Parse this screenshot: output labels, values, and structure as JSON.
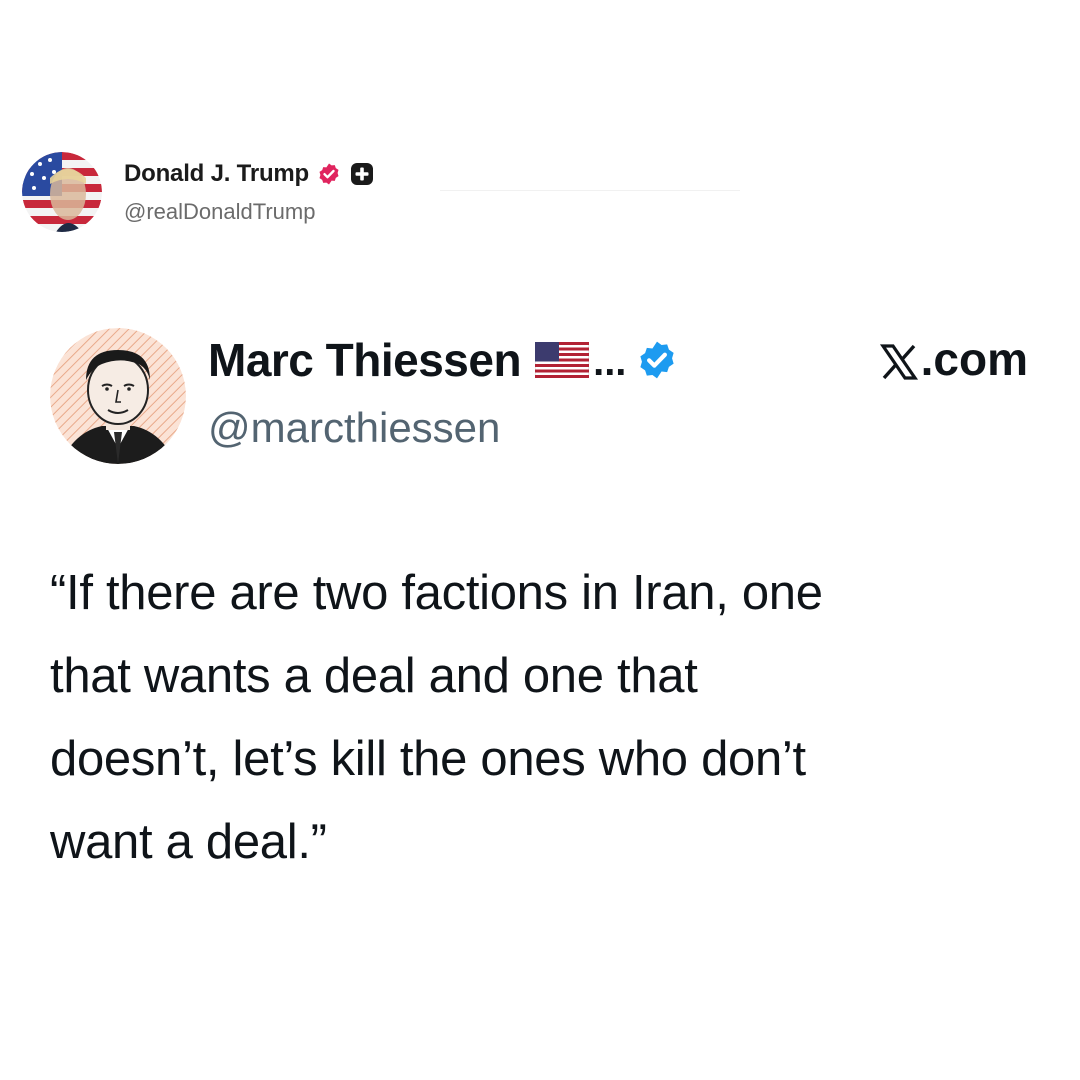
{
  "post": {
    "author_name": "Donald J. Trump",
    "author_handle": "@realDonaldTrump",
    "avatar_icon": "flag-portrait-avatar",
    "badge_icon": "verified-badge-icon",
    "badge_color": "#e0245e",
    "plus_icon": "plus-icon"
  },
  "embedded_tweet": {
    "author_name": "Marc Thiessen",
    "flag_icon": "us-flag-icon",
    "ellipsis": "...",
    "verified_icon": "verified-check-icon",
    "verified_color": "#1d9bf0",
    "author_handle": "@marcthiessen",
    "site_logo_icon": "x-logo-icon",
    "site_label": ".com",
    "text": "“If there are two factions in Iran, one\nthat wants a deal and one that\ndoesn’t, let’s kill the ones who don’t\nwant a deal.”"
  }
}
